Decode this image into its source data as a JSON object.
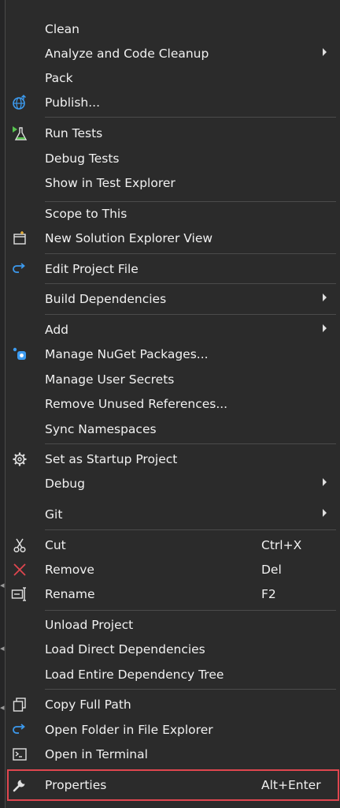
{
  "menu": {
    "items": [
      {
        "label": "Clean",
        "shortcut": "",
        "submenu": false,
        "icon": ""
      },
      {
        "label": "Analyze and Code Cleanup",
        "shortcut": "",
        "submenu": true,
        "icon": ""
      },
      {
        "label": "Pack",
        "shortcut": "",
        "submenu": false,
        "icon": ""
      },
      {
        "label": "Publish...",
        "shortcut": "",
        "submenu": false,
        "icon": "publish-globe-icon"
      },
      {
        "label": "Run Tests",
        "shortcut": "",
        "submenu": false,
        "icon": "run-tests-flask-icon"
      },
      {
        "label": "Debug Tests",
        "shortcut": "",
        "submenu": false,
        "icon": ""
      },
      {
        "label": "Show in Test Explorer",
        "shortcut": "",
        "submenu": false,
        "icon": ""
      },
      {
        "label": "Scope to This",
        "shortcut": "",
        "submenu": false,
        "icon": ""
      },
      {
        "label": "New Solution Explorer View",
        "shortcut": "",
        "submenu": false,
        "icon": "new-window-icon"
      },
      {
        "label": "Edit Project File",
        "shortcut": "",
        "submenu": false,
        "icon": "redo-arrow-icon"
      },
      {
        "label": "Build Dependencies",
        "shortcut": "",
        "submenu": true,
        "icon": ""
      },
      {
        "label": "Add",
        "shortcut": "",
        "submenu": true,
        "icon": ""
      },
      {
        "label": "Manage NuGet Packages...",
        "shortcut": "",
        "submenu": false,
        "icon": "nuget-icon"
      },
      {
        "label": "Manage User Secrets",
        "shortcut": "",
        "submenu": false,
        "icon": ""
      },
      {
        "label": "Remove Unused References...",
        "shortcut": "",
        "submenu": false,
        "icon": ""
      },
      {
        "label": "Sync Namespaces",
        "shortcut": "",
        "submenu": false,
        "icon": ""
      },
      {
        "label": "Set as Startup Project",
        "shortcut": "",
        "submenu": false,
        "icon": "gear-icon"
      },
      {
        "label": "Debug",
        "shortcut": "",
        "submenu": true,
        "icon": ""
      },
      {
        "label": "Git",
        "shortcut": "",
        "submenu": true,
        "icon": ""
      },
      {
        "label": "Cut",
        "shortcut": "Ctrl+X",
        "submenu": false,
        "icon": "scissors-icon"
      },
      {
        "label": "Remove",
        "shortcut": "Del",
        "submenu": false,
        "icon": "remove-x-icon"
      },
      {
        "label": "Rename",
        "shortcut": "F2",
        "submenu": false,
        "icon": "rename-icon"
      },
      {
        "label": "Unload Project",
        "shortcut": "",
        "submenu": false,
        "icon": ""
      },
      {
        "label": "Load Direct Dependencies",
        "shortcut": "",
        "submenu": false,
        "icon": ""
      },
      {
        "label": "Load Entire Dependency Tree",
        "shortcut": "",
        "submenu": false,
        "icon": ""
      },
      {
        "label": "Copy Full Path",
        "shortcut": "",
        "submenu": false,
        "icon": "copy-icon"
      },
      {
        "label": "Open Folder in File Explorer",
        "shortcut": "",
        "submenu": false,
        "icon": "open-folder-arrow-icon"
      },
      {
        "label": "Open in Terminal",
        "shortcut": "",
        "submenu": false,
        "icon": "terminal-icon"
      },
      {
        "label": "Properties",
        "shortcut": "Alt+Enter",
        "submenu": false,
        "icon": "wrench-icon",
        "highlighted": true
      }
    ]
  },
  "colors": {
    "menu_background": "#2b2b2b",
    "text": "#f1f1f1",
    "separator": "#4b4b4b",
    "highlight_border": "#e0464f",
    "accent_blue": "#3c9bf0",
    "accent_green": "#57c24f",
    "remove_red": "#e0464f"
  }
}
